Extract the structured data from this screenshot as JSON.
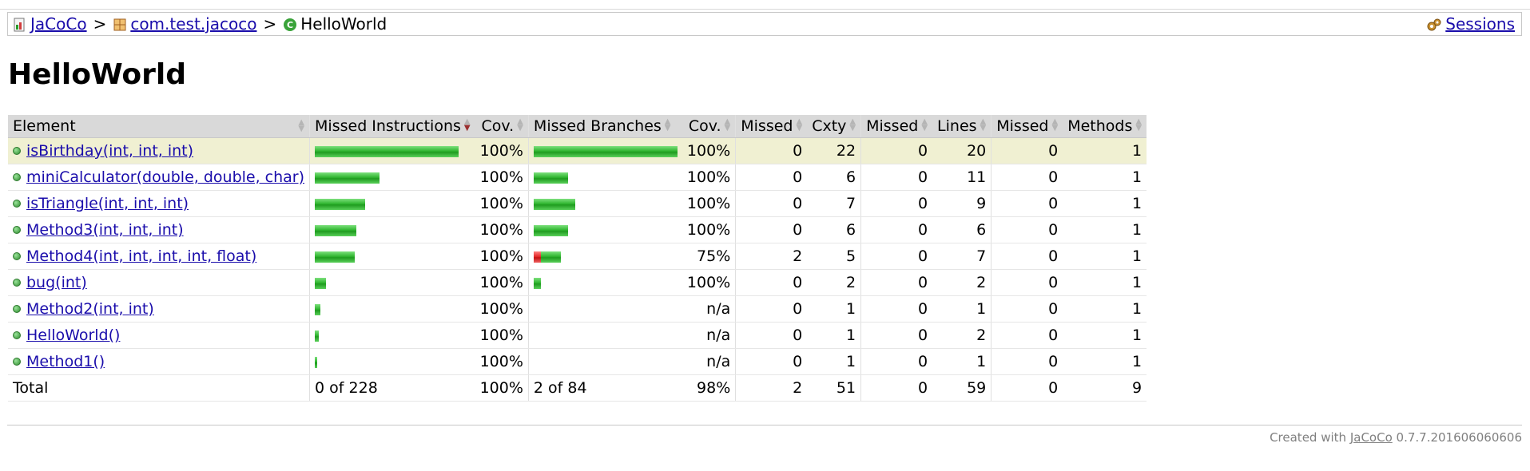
{
  "breadcrumb": {
    "items": [
      "JaCoCo",
      "com.test.jacoco",
      "HelloWorld"
    ],
    "separator": ">",
    "sessions": "Sessions"
  },
  "page_title": "HelloWorld",
  "table": {
    "headers": [
      "Element",
      "Missed Instructions",
      "Cov.",
      "Missed Branches",
      "Cov.",
      "Missed",
      "Cxty",
      "Missed",
      "Lines",
      "Missed",
      "Methods"
    ],
    "rows": [
      {
        "name": "isBirthday(int, int, int)",
        "instr_fraction": 1.0,
        "instr_cov": "100%",
        "branch_red": 0,
        "branch_green": 1.0,
        "branch_cov": "100%",
        "missed_cxty": "0",
        "cxty": "22",
        "missed_lines": "0",
        "lines": "20",
        "missed_methods": "0",
        "methods": "1",
        "highlight": true
      },
      {
        "name": "miniCalculator(double, double, char)",
        "instr_fraction": 0.45,
        "instr_cov": "100%",
        "branch_red": 0,
        "branch_green": 0.24,
        "branch_cov": "100%",
        "missed_cxty": "0",
        "cxty": "6",
        "missed_lines": "0",
        "lines": "11",
        "missed_methods": "0",
        "methods": "1"
      },
      {
        "name": "isTriangle(int, int, int)",
        "instr_fraction": 0.35,
        "instr_cov": "100%",
        "branch_red": 0,
        "branch_green": 0.29,
        "branch_cov": "100%",
        "missed_cxty": "0",
        "cxty": "7",
        "missed_lines": "0",
        "lines": "9",
        "missed_methods": "0",
        "methods": "1"
      },
      {
        "name": "Method3(int, int, int)",
        "instr_fraction": 0.29,
        "instr_cov": "100%",
        "branch_red": 0,
        "branch_green": 0.24,
        "branch_cov": "100%",
        "missed_cxty": "0",
        "cxty": "6",
        "missed_lines": "0",
        "lines": "6",
        "missed_methods": "0",
        "methods": "1"
      },
      {
        "name": "Method4(int, int, int, int, float)",
        "instr_fraction": 0.28,
        "instr_cov": "100%",
        "branch_red": 0.05,
        "branch_green": 0.14,
        "branch_cov": "75%",
        "missed_cxty": "2",
        "cxty": "5",
        "missed_lines": "0",
        "lines": "7",
        "missed_methods": "0",
        "methods": "1"
      },
      {
        "name": "bug(int)",
        "instr_fraction": 0.08,
        "instr_cov": "100%",
        "branch_red": 0,
        "branch_green": 0.05,
        "branch_cov": "100%",
        "missed_cxty": "0",
        "cxty": "2",
        "missed_lines": "0",
        "lines": "2",
        "missed_methods": "0",
        "methods": "1"
      },
      {
        "name": "Method2(int, int)",
        "instr_fraction": 0.04,
        "instr_cov": "100%",
        "branch_red": 0,
        "branch_green": 0,
        "branch_cov": "n/a",
        "missed_cxty": "0",
        "cxty": "1",
        "missed_lines": "0",
        "lines": "1",
        "missed_methods": "0",
        "methods": "1"
      },
      {
        "name": "HelloWorld()",
        "instr_fraction": 0.03,
        "instr_cov": "100%",
        "branch_red": 0,
        "branch_green": 0,
        "branch_cov": "n/a",
        "missed_cxty": "0",
        "cxty": "1",
        "missed_lines": "0",
        "lines": "2",
        "missed_methods": "0",
        "methods": "1"
      },
      {
        "name": "Method1()",
        "instr_fraction": 0.015,
        "instr_cov": "100%",
        "branch_red": 0,
        "branch_green": 0,
        "branch_cov": "n/a",
        "missed_cxty": "0",
        "cxty": "1",
        "missed_lines": "0",
        "lines": "1",
        "missed_methods": "0",
        "methods": "1"
      }
    ],
    "total": {
      "label": "Total",
      "instr": "0 of 228",
      "instr_cov": "100%",
      "branch": "2 of 84",
      "branch_cov": "98%",
      "missed_cxty": "2",
      "cxty": "51",
      "missed_lines": "0",
      "lines": "59",
      "missed_methods": "0",
      "methods": "9"
    }
  },
  "footer": {
    "prefix": "Created with",
    "link": "JaCoCo",
    "version": "0.7.7.201606060606"
  },
  "colors": {
    "bar_green": "#2fb52f",
    "bar_red": "#e02020",
    "highlight_row": "#f0f0d2",
    "header_bg": "#d9d9d9"
  }
}
